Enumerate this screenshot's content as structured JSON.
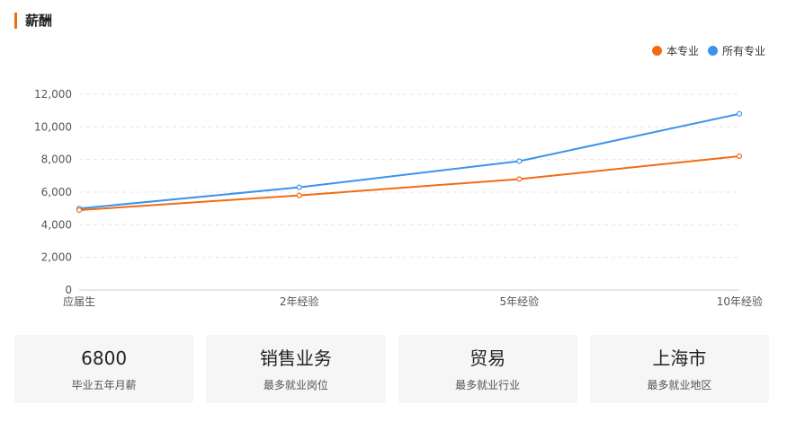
{
  "section": {
    "title": "薪酬"
  },
  "chart_data": {
    "type": "line",
    "categories": [
      "应届生",
      "2年经验",
      "5年经验",
      "10年经验"
    ],
    "series": [
      {
        "name": "本专业",
        "values": [
          4900,
          5800,
          6800,
          8200
        ],
        "color": "#f26b12"
      },
      {
        "name": "所有专业",
        "values": [
          5000,
          6300,
          7900,
          10800
        ],
        "color": "#3a93ec"
      }
    ],
    "ylim": [
      0,
      12000
    ],
    "yticks": [
      0,
      2000,
      4000,
      6000,
      8000,
      10000,
      12000
    ],
    "ytick_labels": [
      "0",
      "2,000",
      "4,000",
      "6,000",
      "8,000",
      "10,000",
      "12,000"
    ],
    "grid": true,
    "legend_position": "top-right"
  },
  "cards": [
    {
      "value": "6800",
      "label": "毕业五年月薪"
    },
    {
      "value": "销售业务",
      "label": "最多就业岗位"
    },
    {
      "value": "贸易",
      "label": "最多就业行业"
    },
    {
      "value": "上海市",
      "label": "最多就业地区"
    }
  ]
}
